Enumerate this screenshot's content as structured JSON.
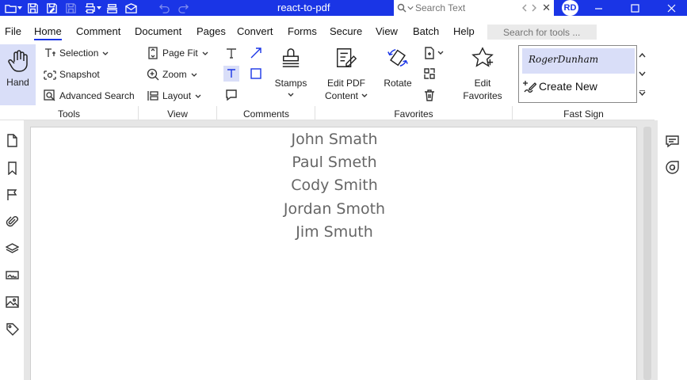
{
  "window": {
    "title": "react-to-pdf",
    "search_placeholder": "Search Text",
    "avatar_initials": "RD",
    "accent_color": "#1a35e6"
  },
  "quick_access": [
    "open-folder-icon",
    "save-icon",
    "save-as-icon",
    "save-all-icon",
    "print-icon",
    "scan-icon",
    "email-icon",
    "undo-icon",
    "redo-icon"
  ],
  "menu": {
    "items": [
      "File",
      "Home",
      "Comment",
      "Document",
      "Pages",
      "Convert",
      "Forms",
      "Secure",
      "View",
      "Batch",
      "Help"
    ],
    "active": "Home",
    "tools_search_placeholder": "Search for tools ..."
  },
  "ribbon": {
    "tools": {
      "label": "Tools",
      "hand": "Hand",
      "selection": "Selection",
      "snapshot": "Snapshot",
      "advanced_search": "Advanced Search"
    },
    "view": {
      "label": "View",
      "page_fit": "Page Fit",
      "zoom": "Zoom",
      "layout": "Layout"
    },
    "comments": {
      "label": "Comments",
      "stamps": "Stamps"
    },
    "favorites": {
      "label": "Favorites",
      "edit_pdf_line1": "Edit PDF",
      "edit_pdf_line2": "Content",
      "rotate": "Rotate",
      "edit_favorites_line1": "Edit",
      "edit_favorites_line2": "Favorites"
    },
    "fast_sign": {
      "label": "Fast Sign",
      "signature": "RogerDunham",
      "create_new": "Create New"
    }
  },
  "document": {
    "names": [
      "John Smath",
      "Paul Smeth",
      "Cody Smith",
      "Jordan Smoth",
      "Jim Smuth"
    ]
  }
}
